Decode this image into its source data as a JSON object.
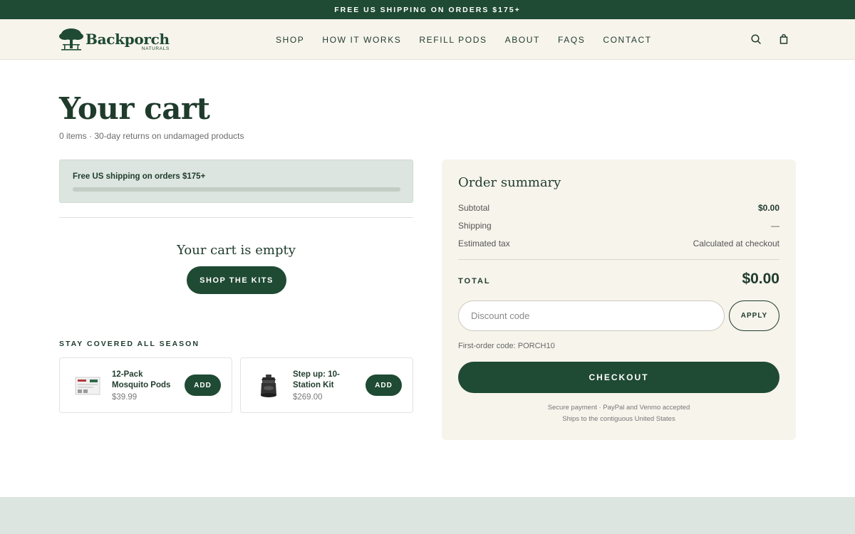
{
  "announcement": "FREE US SHIPPING ON ORDERS $175+",
  "brand": {
    "name": "Backporch",
    "sub": "NATURALS"
  },
  "nav": [
    "SHOP",
    "HOW IT WORKS",
    "REFILL PODS",
    "ABOUT",
    "FAQS",
    "CONTACT"
  ],
  "header_icons": [
    "search-icon",
    "shopping-bag-icon"
  ],
  "cart": {
    "title": "Your cart",
    "subtitle": "0 items · 30-day returns on undamaged products",
    "shipping_message": "Free US shipping on orders $175+",
    "shipping_progress": 0,
    "empty_message": "Your cart is empty",
    "shop_button": "SHOP THE KITS"
  },
  "upsell": {
    "title": "STAY COVERED ALL SEASON",
    "products": [
      {
        "name": "12-Pack Mosquito Pods",
        "price": "$39.99",
        "button": "ADD",
        "icon": "pods-package-icon"
      },
      {
        "name": "Step up: 10-Station Kit",
        "price": "$269.00",
        "button": "ADD",
        "icon": "trap-station-icon"
      }
    ]
  },
  "summary": {
    "title": "Order summary",
    "rows": [
      {
        "label": "Subtotal",
        "value": "$0.00"
      },
      {
        "label": "Shipping",
        "value": "—"
      },
      {
        "label": "Estimated tax",
        "value": "Calculated at checkout"
      }
    ],
    "total_label": "TOTAL",
    "total_value": "$0.00",
    "discount_placeholder": "Discount code",
    "apply_button": "APPLY",
    "code_note": "First-order code: PORCH10",
    "checkout_button": "CHECKOUT",
    "secure_line1": "Secure payment · PayPal and Venmo accepted",
    "secure_line2": "Ships to the contiguous United States"
  },
  "colors": {
    "brand_green": "#1f4a33",
    "cream": "#f7f4ec",
    "sage": "#dce5df"
  }
}
